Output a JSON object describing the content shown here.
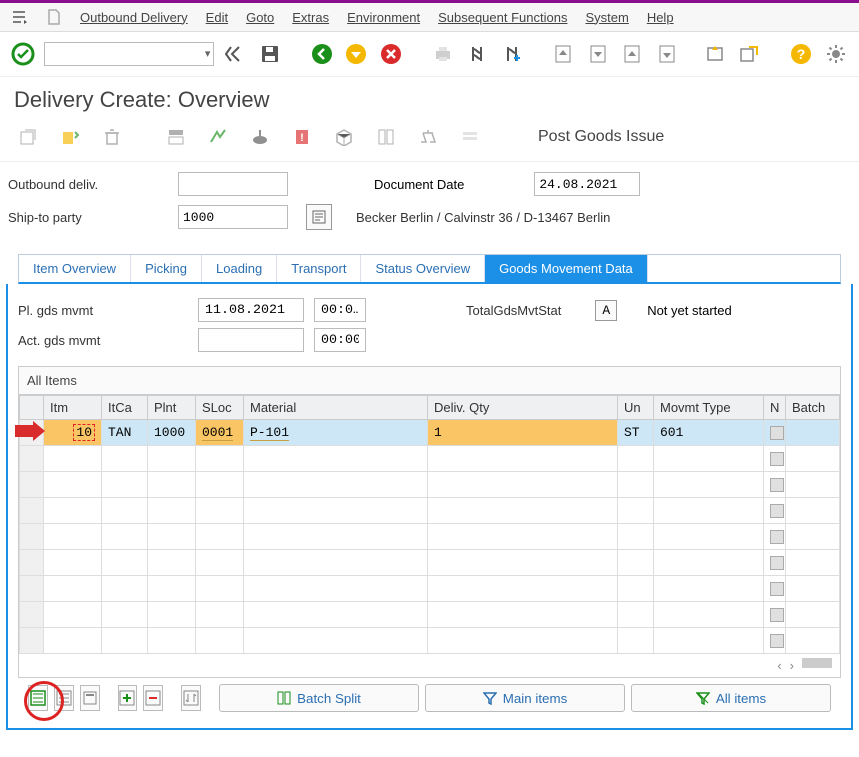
{
  "menu": {
    "items": [
      "Outbound Delivery",
      "Edit",
      "Goto",
      "Extras",
      "Environment",
      "Subsequent Functions",
      "System",
      "Help"
    ]
  },
  "page_title": "Delivery  Create: Overview",
  "post_goods_issue": "Post Goods Issue",
  "header": {
    "outbound_deliv_label": "Outbound deliv.",
    "outbound_deliv_value": "",
    "doc_date_label": "Document Date",
    "doc_date_value": "24.08.2021",
    "ship_to_label": "Ship-to party",
    "ship_to_value": "1000",
    "ship_to_text": "Becker Berlin / Calvinstr 36 / D-13467 Berlin"
  },
  "tabs": [
    "Item Overview",
    "Picking",
    "Loading",
    "Transport",
    "Status Overview",
    "Goods Movement Data"
  ],
  "gm": {
    "pl_label": "Pl. gds mvmt",
    "pl_date": "11.08.2021",
    "pl_time": "00:0…",
    "act_label": "Act. gds mvmt",
    "act_date": "",
    "act_time": "00:00",
    "stat_label": "TotalGdsMvtStat",
    "stat_value": "A",
    "stat_text": "Not yet started"
  },
  "grid": {
    "section_title": "All Items",
    "cols": [
      "Itm",
      "ItCa",
      "Plnt",
      "SLoc",
      "Material",
      "Deliv. Qty",
      "Un",
      "Movmt Type",
      "N",
      "Batch"
    ],
    "row": {
      "itm": "10",
      "itca": "TAN",
      "plnt": "1000",
      "sloc": "0001",
      "material": "P-101",
      "deliv_qty": "1",
      "un": "ST",
      "movmt_type": "601",
      "batch": ""
    }
  },
  "bottom": {
    "batch_split": "Batch Split",
    "main_items": "Main items",
    "all_items": "All items"
  }
}
